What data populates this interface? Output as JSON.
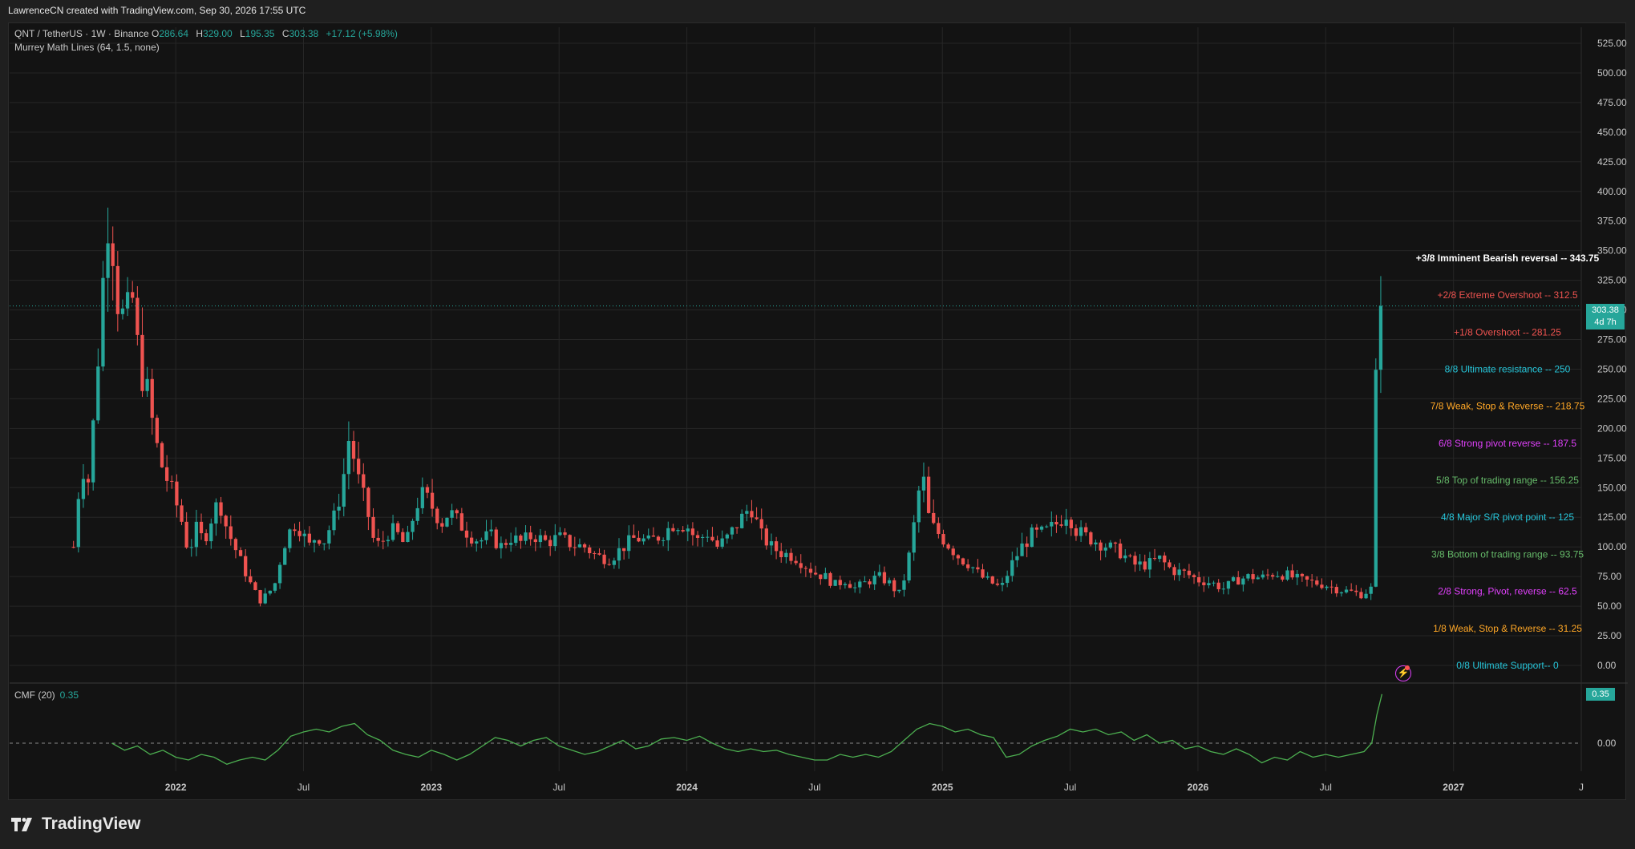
{
  "header": {
    "attribution": "LawrenceCN created with TradingView.com, Sep 30, 2026 17:55 UTC"
  },
  "legend": {
    "symbol": "QNT / TetherUS · 1W · Binance",
    "open_key": "O",
    "open": "286.64",
    "high_key": "H",
    "high": "329.00",
    "low_key": "L",
    "low": "195.35",
    "close_key": "C",
    "close": "303.38",
    "change": "+17.12 (+5.98%)",
    "indicator": "Murrey Math Lines (64, 1.5, none)"
  },
  "cmf": {
    "label": "CMF (20)",
    "value": "0.35",
    "tag": "0.35"
  },
  "price_tag": {
    "price": "303.38",
    "countdown": "4d 7h"
  },
  "brand": {
    "name": "TradingView"
  },
  "colors": {
    "up": "#26a69a",
    "down": "#ef5350",
    "cmf_line": "#4caf50",
    "grid": "#262626",
    "background": "#131313"
  },
  "icons": {
    "alert": "lightning-bolt-icon",
    "brand": "tradingview-logo-icon"
  },
  "chart_data": {
    "type": "candlestick",
    "title": "QNT / TetherUS · 1W · Binance",
    "ylim": [
      0,
      525
    ],
    "y_ticks": [
      "525.00",
      "500.00",
      "475.00",
      "450.00",
      "425.00",
      "400.00",
      "375.00",
      "350.00",
      "325.00",
      "300.00",
      "275.00",
      "250.00",
      "225.00",
      "200.00",
      "175.00",
      "150.00",
      "125.00",
      "100.00",
      "75.00",
      "50.00",
      "25.00",
      "0.00"
    ],
    "y_tick_values": [
      525,
      500,
      475,
      450,
      425,
      400,
      375,
      350,
      325,
      300,
      275,
      250,
      225,
      200,
      175,
      150,
      125,
      100,
      75,
      50,
      25,
      0
    ],
    "x_ticks": [
      "2022",
      "Jul",
      "2023",
      "Jul",
      "2024",
      "Jul",
      "2025",
      "Jul",
      "2026",
      "Jul",
      "2027",
      "J"
    ],
    "x_tick_times": [
      2022.0,
      2022.5,
      2023.0,
      2023.5,
      2024.0,
      2024.5,
      2025.0,
      2025.5,
      2026.0,
      2026.5,
      2027.0,
      2027.5
    ],
    "bold_x_ticks": [
      "2022",
      "2023",
      "2024",
      "2025",
      "2026",
      "2027"
    ],
    "xlim": [
      2021.35,
      2027.5
    ],
    "grid": true,
    "price_path": [
      [
        2021.6,
        100
      ],
      [
        2021.63,
        170
      ],
      [
        2021.66,
        155
      ],
      [
        2021.69,
        240
      ],
      [
        2021.72,
        340
      ],
      [
        2021.74,
        390
      ],
      [
        2021.77,
        310
      ],
      [
        2021.8,
        290
      ],
      [
        2021.83,
        310
      ],
      [
        2021.86,
        250
      ],
      [
        2021.89,
        230
      ],
      [
        2021.92,
        190
      ],
      [
        2021.95,
        165
      ],
      [
        2021.98,
        150
      ],
      [
        2022.02,
        125
      ],
      [
        2022.05,
        95
      ],
      [
        2022.08,
        115
      ],
      [
        2022.11,
        105
      ],
      [
        2022.14,
        125
      ],
      [
        2022.17,
        140
      ],
      [
        2022.2,
        115
      ],
      [
        2022.23,
        100
      ],
      [
        2022.27,
        80
      ],
      [
        2022.3,
        65
      ],
      [
        2022.33,
        55
      ],
      [
        2022.36,
        60
      ],
      [
        2022.39,
        70
      ],
      [
        2022.42,
        100
      ],
      [
        2022.46,
        120
      ],
      [
        2022.49,
        115
      ],
      [
        2022.52,
        100
      ],
      [
        2022.55,
        110
      ],
      [
        2022.58,
        105
      ],
      [
        2022.62,
        125
      ],
      [
        2022.65,
        150
      ],
      [
        2022.68,
        195
      ],
      [
        2022.71,
        160
      ],
      [
        2022.75,
        130
      ],
      [
        2022.78,
        100
      ],
      [
        2022.81,
        105
      ],
      [
        2022.84,
        115
      ],
      [
        2022.87,
        110
      ],
      [
        2022.9,
        100
      ],
      [
        2022.94,
        135
      ],
      [
        2022.97,
        145
      ],
      [
        2023.0,
        135
      ],
      [
        2023.04,
        120
      ],
      [
        2023.07,
        130
      ],
      [
        2023.11,
        120
      ],
      [
        2023.15,
        110
      ],
      [
        2023.19,
        105
      ],
      [
        2023.23,
        110
      ],
      [
        2023.27,
        100
      ],
      [
        2023.31,
        108
      ],
      [
        2023.35,
        104
      ],
      [
        2023.4,
        110
      ],
      [
        2023.45,
        104
      ],
      [
        2023.5,
        108
      ],
      [
        2023.55,
        102
      ],
      [
        2023.6,
        100
      ],
      [
        2023.65,
        92
      ],
      [
        2023.7,
        90
      ],
      [
        2023.75,
        100
      ],
      [
        2023.8,
        108
      ],
      [
        2023.85,
        104
      ],
      [
        2023.9,
        110
      ],
      [
        2023.95,
        120
      ],
      [
        2024.0,
        118
      ],
      [
        2024.04,
        105
      ],
      [
        2024.08,
        112
      ],
      [
        2024.12,
        100
      ],
      [
        2024.16,
        108
      ],
      [
        2024.2,
        120
      ],
      [
        2024.25,
        135
      ],
      [
        2024.29,
        110
      ],
      [
        2024.33,
        100
      ],
      [
        2024.37,
        95
      ],
      [
        2024.42,
        92
      ],
      [
        2024.46,
        85
      ],
      [
        2024.5,
        78
      ],
      [
        2024.54,
        75
      ],
      [
        2024.58,
        68
      ],
      [
        2024.62,
        72
      ],
      [
        2024.66,
        65
      ],
      [
        2024.7,
        70
      ],
      [
        2024.75,
        75
      ],
      [
        2024.79,
        70
      ],
      [
        2024.83,
        60
      ],
      [
        2024.86,
        80
      ],
      [
        2024.89,
        120
      ],
      [
        2024.92,
        165
      ],
      [
        2024.95,
        120
      ],
      [
        2024.99,
        110
      ],
      [
        2025.03,
        100
      ],
      [
        2025.07,
        90
      ],
      [
        2025.11,
        85
      ],
      [
        2025.15,
        75
      ],
      [
        2025.19,
        70
      ],
      [
        2025.23,
        65
      ],
      [
        2025.27,
        85
      ],
      [
        2025.31,
        100
      ],
      [
        2025.35,
        110
      ],
      [
        2025.4,
        112
      ],
      [
        2025.45,
        120
      ],
      [
        2025.49,
        130
      ],
      [
        2025.52,
        115
      ],
      [
        2025.55,
        110
      ],
      [
        2025.6,
        105
      ],
      [
        2025.65,
        100
      ],
      [
        2025.7,
        95
      ],
      [
        2025.75,
        85
      ],
      [
        2025.8,
        85
      ],
      [
        2025.85,
        90
      ],
      [
        2025.9,
        80
      ],
      [
        2025.95,
        78
      ],
      [
        2026.0,
        72
      ],
      [
        2026.05,
        70
      ],
      [
        2026.1,
        65
      ],
      [
        2026.15,
        72
      ],
      [
        2026.2,
        75
      ],
      [
        2026.25,
        74
      ],
      [
        2026.3,
        78
      ],
      [
        2026.35,
        76
      ],
      [
        2026.4,
        72
      ],
      [
        2026.45,
        70
      ],
      [
        2026.5,
        68
      ],
      [
        2026.55,
        64
      ],
      [
        2026.6,
        62
      ],
      [
        2026.64,
        60
      ],
      [
        2026.68,
        65
      ],
      [
        2026.7,
        280
      ],
      [
        2026.72,
        303.38
      ]
    ],
    "murrey_lines": [
      {
        "label": "+3/8 Imminent Bearish reversal --  343.75",
        "value": 343.75,
        "color": "#ffffff"
      },
      {
        "label": "+2/8 Extreme Overshoot --  312.5",
        "value": 312.5,
        "color": "#ef5350"
      },
      {
        "label": "+1/8 Overshoot --  281.25",
        "value": 281.25,
        "color": "#ef5350"
      },
      {
        "label": "8/8 Ultimate resistance --  250",
        "value": 250,
        "color": "#26c6da"
      },
      {
        "label": "7/8 Weak, Stop & Reverse --  218.75",
        "value": 218.75,
        "color": "#ffa726"
      },
      {
        "label": "6/8 Strong pivot reverse --  187.5",
        "value": 187.5,
        "color": "#e040fb"
      },
      {
        "label": "5/8 Top of trading range --  156.25",
        "value": 156.25,
        "color": "#66bb6a"
      },
      {
        "label": "4/8 Major S/R pivot point --  125",
        "value": 125,
        "color": "#26c6da"
      },
      {
        "label": "3/8 Bottom of trading range --  93.75",
        "value": 93.75,
        "color": "#66bb6a"
      },
      {
        "label": "2/8 Strong, Pivot, reverse --  62.5",
        "value": 62.5,
        "color": "#e040fb"
      },
      {
        "label": "1/8 Weak, Stop & Reverse --  31.25",
        "value": 31.25,
        "color": "#ffa726"
      },
      {
        "label": "0/8 Ultimate Support--  0",
        "value": 0,
        "color": "#26c6da"
      }
    ],
    "current_price": 303.38,
    "cmf_series": {
      "name": "CMF (20)",
      "zero_tick": "0.00",
      "values": [
        [
          2021.75,
          0.0
        ],
        [
          2021.8,
          -0.05
        ],
        [
          2021.85,
          -0.02
        ],
        [
          2021.9,
          -0.08
        ],
        [
          2021.95,
          -0.05
        ],
        [
          2022.0,
          -0.1
        ],
        [
          2022.05,
          -0.12
        ],
        [
          2022.1,
          -0.08
        ],
        [
          2022.15,
          -0.1
        ],
        [
          2022.2,
          -0.15
        ],
        [
          2022.25,
          -0.12
        ],
        [
          2022.3,
          -0.1
        ],
        [
          2022.35,
          -0.12
        ],
        [
          2022.4,
          -0.05
        ],
        [
          2022.45,
          0.05
        ],
        [
          2022.5,
          0.08
        ],
        [
          2022.55,
          0.1
        ],
        [
          2022.6,
          0.08
        ],
        [
          2022.65,
          0.12
        ],
        [
          2022.7,
          0.14
        ],
        [
          2022.75,
          0.06
        ],
        [
          2022.8,
          0.02
        ],
        [
          2022.85,
          -0.05
        ],
        [
          2022.9,
          -0.08
        ],
        [
          2022.95,
          -0.1
        ],
        [
          2023.0,
          -0.05
        ],
        [
          2023.05,
          -0.08
        ],
        [
          2023.1,
          -0.12
        ],
        [
          2023.15,
          -0.08
        ],
        [
          2023.2,
          -0.02
        ],
        [
          2023.25,
          0.04
        ],
        [
          2023.3,
          0.02
        ],
        [
          2023.35,
          -0.02
        ],
        [
          2023.4,
          0.02
        ],
        [
          2023.45,
          0.04
        ],
        [
          2023.5,
          -0.02
        ],
        [
          2023.55,
          -0.05
        ],
        [
          2023.6,
          -0.08
        ],
        [
          2023.65,
          -0.06
        ],
        [
          2023.7,
          -0.02
        ],
        [
          2023.75,
          0.02
        ],
        [
          2023.8,
          -0.04
        ],
        [
          2023.85,
          -0.02
        ],
        [
          2023.9,
          0.03
        ],
        [
          2023.95,
          0.04
        ],
        [
          2024.0,
          0.02
        ],
        [
          2024.05,
          0.05
        ],
        [
          2024.1,
          0.0
        ],
        [
          2024.15,
          -0.04
        ],
        [
          2024.2,
          -0.06
        ],
        [
          2024.25,
          -0.04
        ],
        [
          2024.3,
          -0.06
        ],
        [
          2024.35,
          -0.05
        ],
        [
          2024.4,
          -0.08
        ],
        [
          2024.45,
          -0.1
        ],
        [
          2024.5,
          -0.12
        ],
        [
          2024.55,
          -0.12
        ],
        [
          2024.6,
          -0.08
        ],
        [
          2024.65,
          -0.1
        ],
        [
          2024.7,
          -0.08
        ],
        [
          2024.75,
          -0.1
        ],
        [
          2024.8,
          -0.06
        ],
        [
          2024.85,
          0.02
        ],
        [
          2024.9,
          0.1
        ],
        [
          2024.95,
          0.14
        ],
        [
          2025.0,
          0.12
        ],
        [
          2025.05,
          0.08
        ],
        [
          2025.1,
          0.1
        ],
        [
          2025.15,
          0.06
        ],
        [
          2025.2,
          0.04
        ],
        [
          2025.25,
          -0.1
        ],
        [
          2025.3,
          -0.08
        ],
        [
          2025.35,
          -0.02
        ],
        [
          2025.4,
          0.02
        ],
        [
          2025.45,
          0.05
        ],
        [
          2025.5,
          0.1
        ],
        [
          2025.55,
          0.08
        ],
        [
          2025.6,
          0.1
        ],
        [
          2025.65,
          0.06
        ],
        [
          2025.7,
          0.08
        ],
        [
          2025.75,
          0.02
        ],
        [
          2025.8,
          0.06
        ],
        [
          2025.85,
          0.0
        ],
        [
          2025.9,
          0.02
        ],
        [
          2025.95,
          -0.04
        ],
        [
          2026.0,
          -0.02
        ],
        [
          2026.05,
          -0.06
        ],
        [
          2026.1,
          -0.08
        ],
        [
          2026.15,
          -0.04
        ],
        [
          2026.2,
          -0.08
        ],
        [
          2026.25,
          -0.14
        ],
        [
          2026.3,
          -0.1
        ],
        [
          2026.35,
          -0.12
        ],
        [
          2026.4,
          -0.06
        ],
        [
          2026.45,
          -0.1
        ],
        [
          2026.5,
          -0.08
        ],
        [
          2026.55,
          -0.1
        ],
        [
          2026.6,
          -0.08
        ],
        [
          2026.65,
          -0.06
        ],
        [
          2026.68,
          0.0
        ],
        [
          2026.7,
          0.2
        ],
        [
          2026.72,
          0.35
        ]
      ]
    }
  }
}
